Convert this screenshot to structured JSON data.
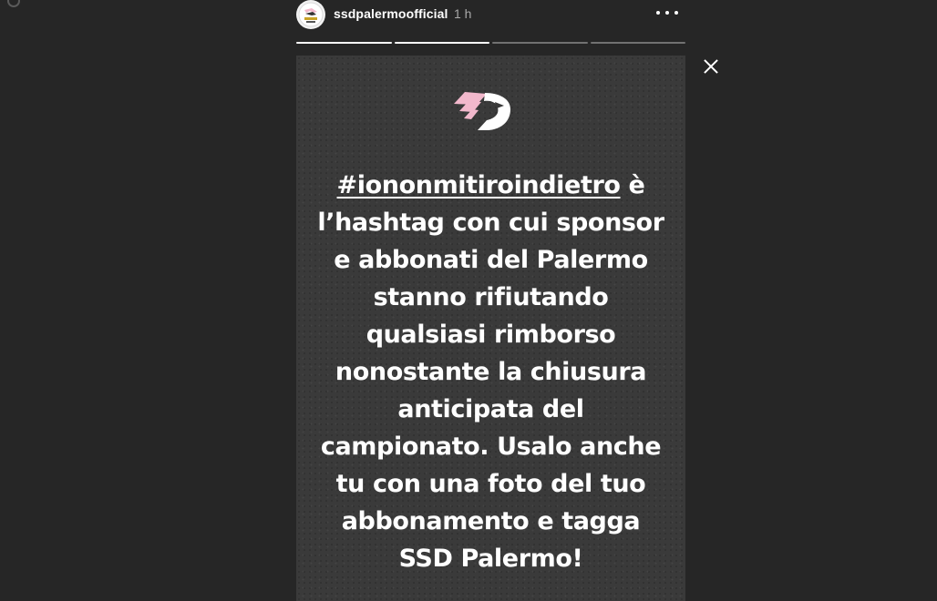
{
  "header": {
    "username": "ssdpalermoofficial",
    "timestamp": "1 h",
    "avatar_icon": "palermo-logo-icon",
    "more_icon": "more-options-icon"
  },
  "progress": {
    "segments": [
      {
        "filled": 1.0
      },
      {
        "filled": 1.0
      },
      {
        "filled": 0.0
      },
      {
        "filled": 0.0
      }
    ]
  },
  "close_icon": "close-icon",
  "story": {
    "logo_icon": "palermo-eagle-logo-icon",
    "hashtag": "#iononmitiroindietro",
    "text": " è l’hashtag con cui sponsor e abbonati del Palermo stanno rifiutando qualsiasi rimborso nonostante la chiusura anticipata del campionato. Usalo anche tu con una foto del tuo abbonamento e tagga SSD Palermo!"
  },
  "colors": {
    "background": "#262626",
    "story_background": "#3a3a3a",
    "text": "#ffffff",
    "logo_pink": "#f2b8cc"
  }
}
